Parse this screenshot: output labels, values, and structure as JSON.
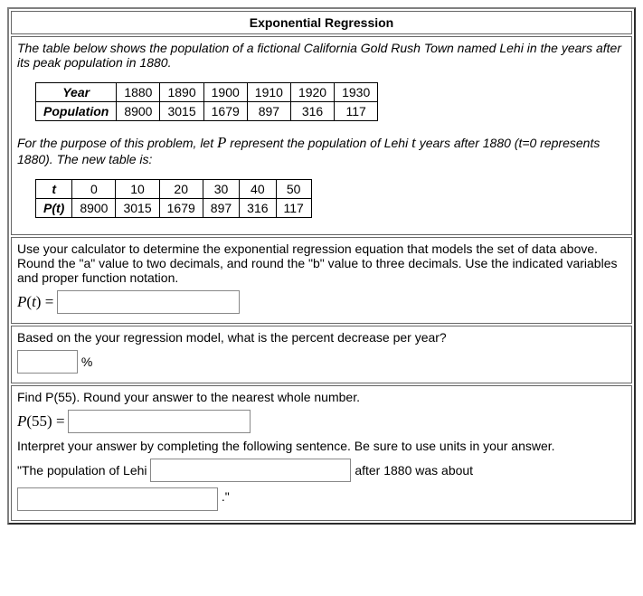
{
  "title": "Exponential Regression",
  "intro1": "The table below shows the population of a fictional California Gold Rush Town named Lehi in the years after its peak population in 1880.",
  "table1": {
    "row1_label": "Year",
    "row2_label": "Population",
    "years": [
      "1880",
      "1890",
      "1900",
      "1910",
      "1920",
      "1930"
    ],
    "population": [
      "8900",
      "3015",
      "1679",
      "897",
      "316",
      "117"
    ]
  },
  "intro2_a": "For the purpose of this problem, let ",
  "intro2_b": " represent the population of Lehi ",
  "intro2_c": " years after 1880 (t=0 represents 1880). The new table is:",
  "var_P": "P",
  "var_t": "t",
  "table2": {
    "row1_label": "t",
    "row2_label": "P(t)",
    "t": [
      "0",
      "10",
      "20",
      "30",
      "40",
      "50"
    ],
    "pt": [
      "8900",
      "3015",
      "1679",
      "897",
      "316",
      "117"
    ]
  },
  "q1_text": "Use your calculator to determine the exponential regression equation that models the set of data above. Round the \"a\" value to two decimals, and round the \"b\" value to three decimals. Use the indicated variables and proper function notation.",
  "q1_label_a": "P",
  "q1_label_b": "(",
  "q1_label_c": "t",
  "q1_label_d": ") = ",
  "q2_text": "Based on the your regression model, what is the percent decrease per year?",
  "q2_unit": "%",
  "q3_text": "Find P(55). Round your answer to the nearest whole number.",
  "q3_label_a": "P",
  "q3_label_b": "(55) = ",
  "q3_interpret": "Interpret your answer by completing the following sentence. Be sure to use units in your answer.",
  "q3_sent_a": "\"The population of Lehi ",
  "q3_sent_b": " after 1880 was about ",
  "q3_sent_c": " .\"",
  "chart_data": {
    "type": "table",
    "series": [
      {
        "name": "Year",
        "values": [
          1880,
          1890,
          1900,
          1910,
          1920,
          1930
        ]
      },
      {
        "name": "Population",
        "values": [
          8900,
          3015,
          1679,
          897,
          316,
          117
        ]
      },
      {
        "name": "t",
        "values": [
          0,
          10,
          20,
          30,
          40,
          50
        ]
      },
      {
        "name": "P(t)",
        "values": [
          8900,
          3015,
          1679,
          897,
          316,
          117
        ]
      }
    ]
  }
}
